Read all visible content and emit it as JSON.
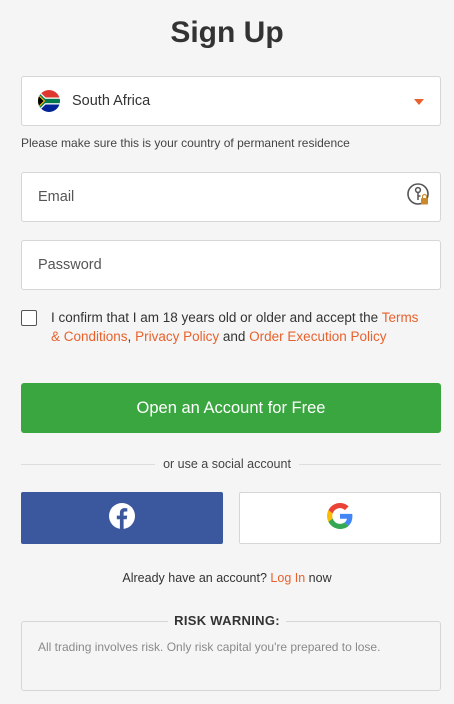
{
  "title": "Sign Up",
  "country": {
    "selected": "South Africa",
    "flag_icon": "south-africa-flag-icon",
    "hint": "Please make sure this is your country of permanent residence"
  },
  "email": {
    "placeholder": "Email",
    "value": ""
  },
  "password": {
    "placeholder": "Password",
    "value": ""
  },
  "consent": {
    "checked": false,
    "text_before": "I confirm that I am 18 years old or older and accept the",
    "terms_link": "Terms & Conditions",
    "comma": ",",
    "privacy_link": "Privacy Policy",
    "and": "and",
    "order_link": "Order Execution Policy"
  },
  "cta_label": "Open an Account for Free",
  "social": {
    "divider_text": "or use a social account",
    "facebook_icon": "facebook-icon",
    "google_icon": "google-icon"
  },
  "login": {
    "prompt": "Already have an account?",
    "link": "Log In",
    "suffix": "now"
  },
  "risk": {
    "title": "RISK WARNING:",
    "text": "All trading involves risk. Only risk capital you're prepared to lose."
  },
  "colors": {
    "accent": "#e8612c",
    "cta": "#3aa63f",
    "facebook": "#3b579d",
    "background": "#f5f5f5"
  }
}
